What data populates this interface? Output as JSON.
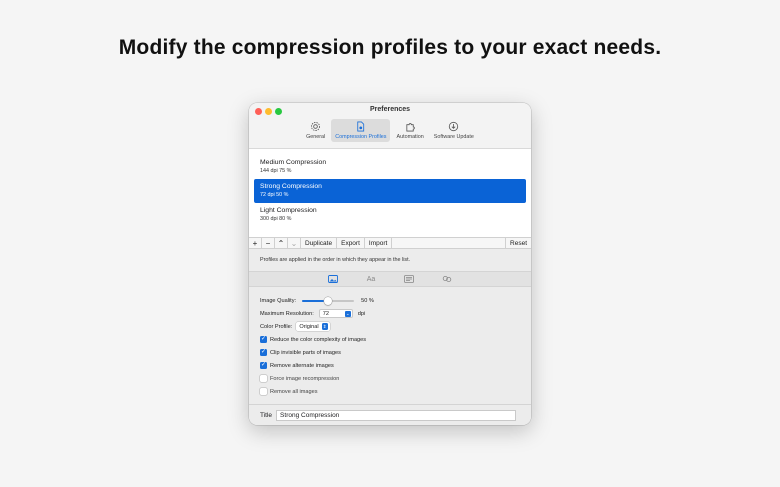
{
  "headline": "Modify the compression profiles to your exact needs.",
  "window": {
    "title": "Preferences",
    "tabs": [
      {
        "label": "General",
        "icon": "gear-icon"
      },
      {
        "label": "Compression Profiles",
        "icon": "document-gear-icon"
      },
      {
        "label": "Automation",
        "icon": "puzzle-icon"
      },
      {
        "label": "Software Update",
        "icon": "download-icon"
      }
    ],
    "active_tab": "Compression Profiles"
  },
  "profiles": [
    {
      "name": "Medium Compression",
      "meta": "144 dpi  75 %",
      "selected": false
    },
    {
      "name": "Strong Compression",
      "meta": "72 dpi  50 %",
      "selected": true
    },
    {
      "name": "Light Compression",
      "meta": "300 dpi  80 %",
      "selected": false
    }
  ],
  "toolbar": {
    "add": "+",
    "remove": "−",
    "move_up": "⌃",
    "move_down": "⌄",
    "duplicate": "Duplicate",
    "export": "Export",
    "import": "Import",
    "reset": "Reset"
  },
  "note": "Profiles are applied in the order in which they appear in the list.",
  "subtabs": [
    "image-icon",
    "font-icon",
    "text-layout-icon",
    "link-icon"
  ],
  "settings": {
    "image_quality_label": "Image Quality:",
    "image_quality_value": "50 %",
    "image_quality_fraction": 0.5,
    "max_res_label": "Maximum Resolution:",
    "max_res_value": "72",
    "max_res_unit": "dpi",
    "color_profile_label": "Color Profile:",
    "color_profile_value": "Original",
    "checkboxes": [
      {
        "label": "Reduce the color complexity of images",
        "checked": true
      },
      {
        "label": "Clip invisible parts of images",
        "checked": true
      },
      {
        "label": "Remove alternate images",
        "checked": true
      },
      {
        "label": "Force image recompression",
        "checked": false
      },
      {
        "label": "Remove all images",
        "checked": false
      }
    ]
  },
  "title_field": {
    "label": "Title",
    "value": "Strong Compression"
  },
  "colors": {
    "accent": "#1a6fd9",
    "selection": "#0a63d6"
  }
}
